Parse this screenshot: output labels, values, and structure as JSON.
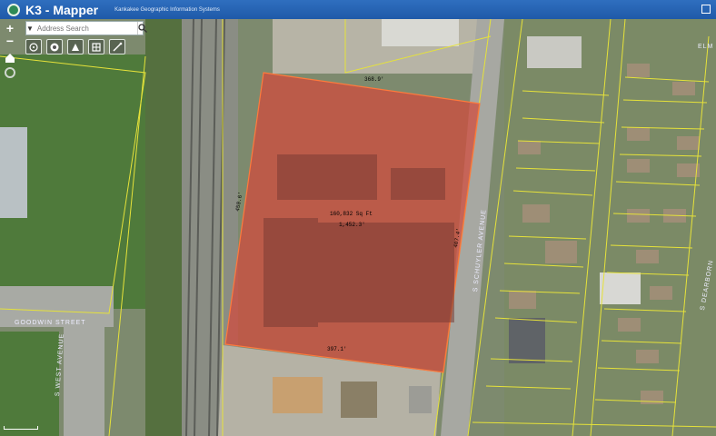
{
  "header": {
    "app_title": "K3 - Mapper",
    "subtitle": "Kankakee Geographic Information Systems"
  },
  "controls": {
    "zoom_in": "+",
    "zoom_out": "−"
  },
  "search": {
    "placeholder": "Address Search"
  },
  "toolbar": {
    "tools": [
      "measure-tool",
      "layers-tool",
      "identify-tool",
      "basemap-tool",
      "draw-tool"
    ]
  },
  "parcel": {
    "area_label": "160,832 Sq Ft",
    "dim_center": "1,452.3'",
    "dim_top": "368.9'",
    "dim_left": "450.6'",
    "dim_right": "407.4'",
    "dim_bottom": "397.1'",
    "fill_color": "#d24a3c"
  },
  "roads": {
    "goodwin": "GOODWIN STREET",
    "schuyler": "S SCHUYLER AVENUE",
    "west": "S WEST AVENUE",
    "dearborn": "S DEARBORN",
    "elm": "ELM"
  }
}
